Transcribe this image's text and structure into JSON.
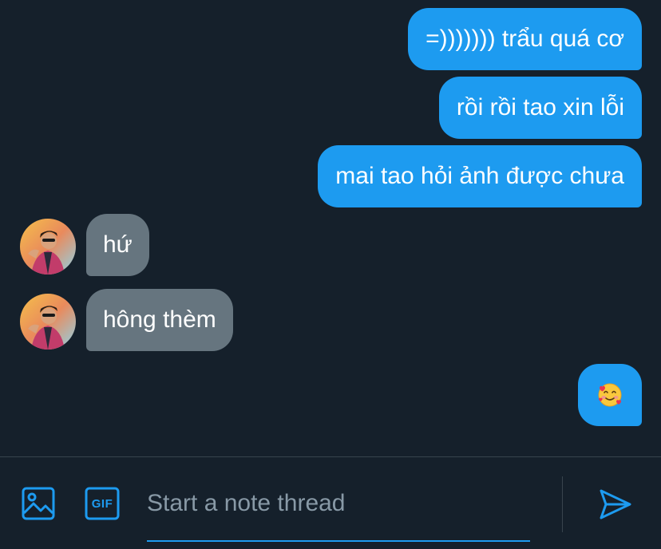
{
  "messages": {
    "outgoing": [
      {
        "text": "=))))))) trẩu quá cơ"
      },
      {
        "text": "rồi rồi tao xin lỗi"
      },
      {
        "text": "mai tao hỏi ảnh được chưa"
      }
    ],
    "incoming": [
      {
        "text": "hứ"
      },
      {
        "text": "hông thèm"
      }
    ],
    "emoji_reply": {
      "icon": "smiling-face-with-hearts-icon"
    }
  },
  "composer": {
    "placeholder": "Start a note thread",
    "media_icon": "image-icon",
    "gif_label": "GIF",
    "send_icon": "send-icon"
  },
  "colors": {
    "background": "#15202b",
    "outgoing_bubble": "#1d9bf0",
    "incoming_bubble": "#66757f",
    "accent": "#1d9bf0"
  }
}
